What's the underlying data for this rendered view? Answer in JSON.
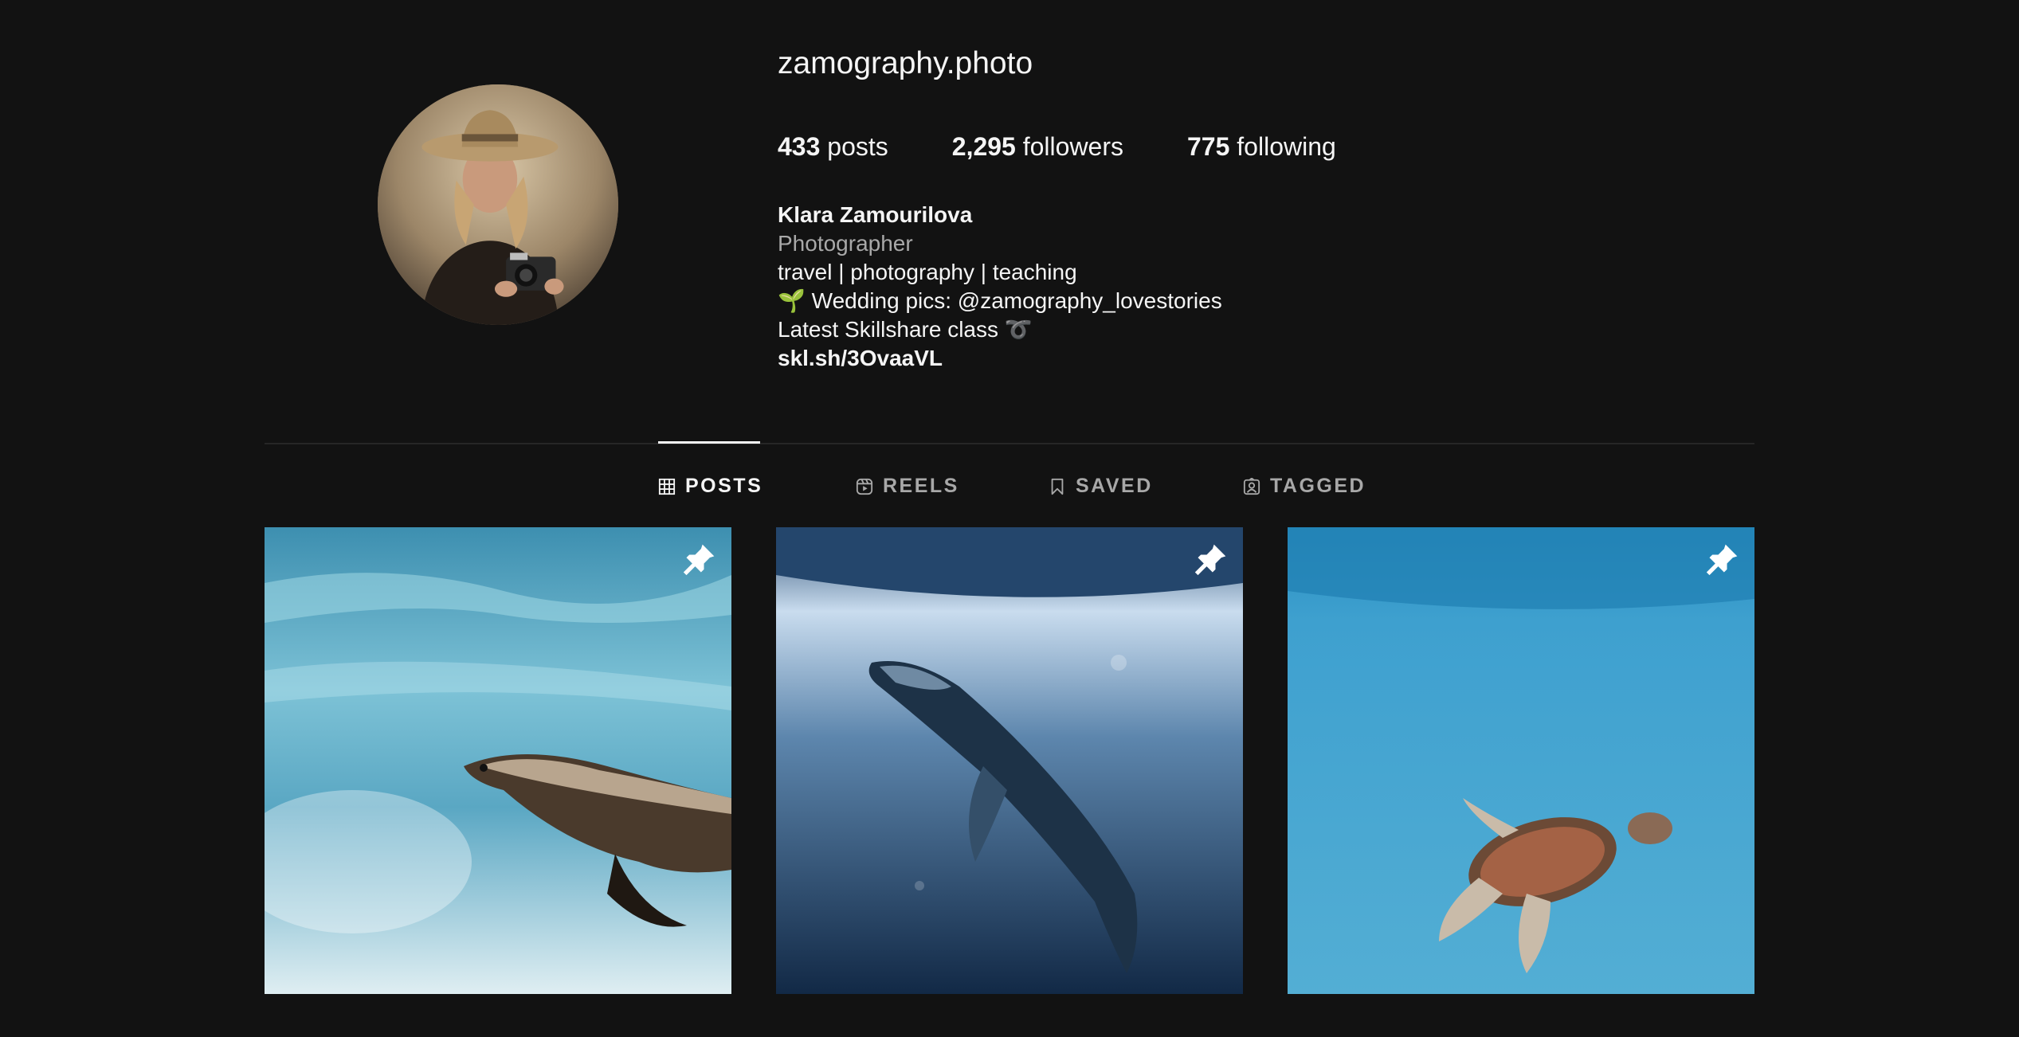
{
  "profile": {
    "username": "zamography.photo",
    "stats": {
      "posts_count": "433",
      "posts_label": "posts",
      "followers_count": "2,295",
      "followers_label": "followers",
      "following_count": "775",
      "following_label": "following"
    },
    "bio": {
      "full_name": "Klara Zamourilova",
      "category": "Photographer",
      "line1": "travel | photography | teaching",
      "line2_emoji": "🌱",
      "line2": "Wedding pics: @zamography_lovestories",
      "line3": "Latest Skillshare class",
      "line3_emoji": "➰",
      "link": "skl.sh/3OvaaVL"
    }
  },
  "tabs": [
    {
      "label": "POSTS",
      "icon": "grid-icon",
      "active": true
    },
    {
      "label": "REELS",
      "icon": "reels-icon",
      "active": false
    },
    {
      "label": "SAVED",
      "icon": "bookmark-icon",
      "active": false
    },
    {
      "label": "TAGGED",
      "icon": "tagged-user-icon",
      "active": false
    }
  ],
  "posts": [
    {
      "subject": "sea-lion",
      "pinned": true
    },
    {
      "subject": "humpback-whale",
      "pinned": true
    },
    {
      "subject": "sea-turtle",
      "pinned": true
    }
  ],
  "colors": {
    "background": "#121212",
    "text_primary": "#f5f5f5",
    "text_secondary": "#a8a8a8",
    "divider": "#262626"
  }
}
